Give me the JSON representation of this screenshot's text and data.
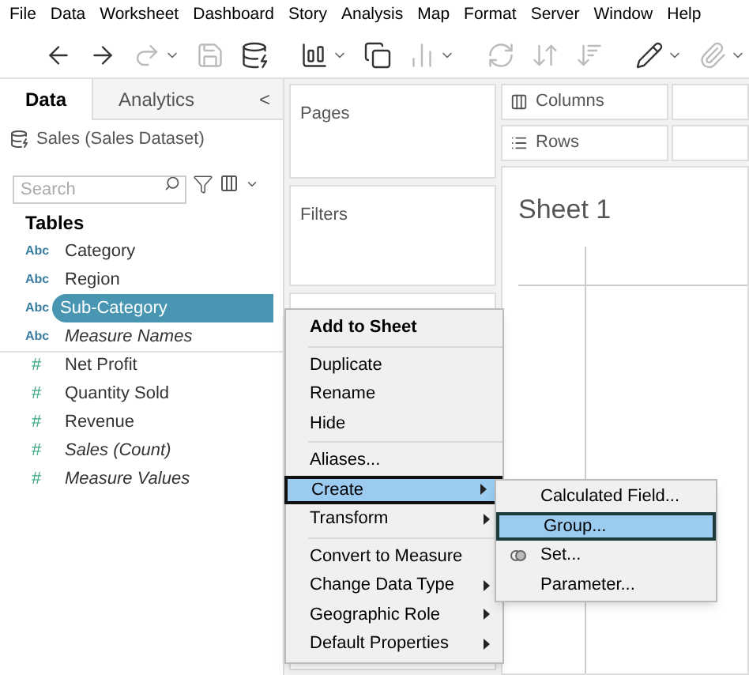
{
  "menu_bar": [
    "File",
    "Data",
    "Worksheet",
    "Dashboard",
    "Story",
    "Analysis",
    "Map",
    "Format",
    "Server",
    "Window",
    "Help"
  ],
  "side_panel": {
    "tabs": [
      {
        "label": "Data",
        "selected": true
      },
      {
        "label": "Analytics",
        "selected": false
      }
    ],
    "collapse": "<",
    "data_source": "Sales (Sales Dataset)",
    "search": {
      "placeholder": "Search"
    },
    "tables_heading": "Tables",
    "fields": [
      {
        "type_label": "Abc",
        "name": "Category",
        "kind": "dimension",
        "italic": false,
        "selected": false
      },
      {
        "type_label": "Abc",
        "name": "Region",
        "kind": "dimension",
        "italic": false,
        "selected": false
      },
      {
        "type_label": "Abc",
        "name": "Sub-Category",
        "kind": "dimension",
        "italic": false,
        "selected": true
      },
      {
        "type_label": "Abc",
        "name": "Measure Names",
        "kind": "dimension",
        "italic": true,
        "selected": false
      },
      {
        "type_label": "#",
        "name": "Net Profit",
        "kind": "measure",
        "italic": false,
        "selected": false
      },
      {
        "type_label": "#",
        "name": "Quantity Sold",
        "kind": "measure",
        "italic": false,
        "selected": false
      },
      {
        "type_label": "#",
        "name": "Revenue",
        "kind": "measure",
        "italic": false,
        "selected": false
      },
      {
        "type_label": "#",
        "name": "Sales (Count)",
        "kind": "measure",
        "italic": true,
        "selected": false
      },
      {
        "type_label": "#",
        "name": "Measure Values",
        "kind": "measure",
        "italic": true,
        "selected": false
      }
    ]
  },
  "cards": {
    "pages": "Pages",
    "filters": "Filters"
  },
  "shelves": {
    "columns": "Columns",
    "rows": "Rows"
  },
  "sheet_title": "Sheet 1",
  "context_menu": {
    "groups": [
      [
        {
          "label": "Add to Sheet",
          "bold": true,
          "has_submenu": false,
          "selected": false
        }
      ],
      [
        {
          "label": "Duplicate",
          "bold": false,
          "has_submenu": false,
          "selected": false
        },
        {
          "label": "Rename",
          "bold": false,
          "has_submenu": false,
          "selected": false
        },
        {
          "label": "Hide",
          "bold": false,
          "has_submenu": false,
          "selected": false
        }
      ],
      [
        {
          "label": "Aliases...",
          "bold": false,
          "has_submenu": false,
          "selected": false
        },
        {
          "label": "Create",
          "bold": false,
          "has_submenu": true,
          "selected": true
        },
        {
          "label": "Transform",
          "bold": false,
          "has_submenu": true,
          "selected": false
        }
      ],
      [
        {
          "label": "Convert to Measure",
          "bold": false,
          "has_submenu": false,
          "selected": false
        },
        {
          "label": "Change Data Type",
          "bold": false,
          "has_submenu": true,
          "selected": false
        },
        {
          "label": "Geographic Role",
          "bold": false,
          "has_submenu": true,
          "selected": false
        },
        {
          "label": "Default Properties",
          "bold": false,
          "has_submenu": true,
          "selected": false
        }
      ]
    ]
  },
  "submenu": {
    "items": [
      {
        "label": "Calculated Field...",
        "has_icon": false,
        "selected": false
      },
      {
        "label": "Group...",
        "has_icon": false,
        "selected": true
      },
      {
        "label": "Set...",
        "has_icon": true,
        "selected": false
      },
      {
        "label": "Parameter...",
        "has_icon": false,
        "selected": false
      }
    ]
  }
}
